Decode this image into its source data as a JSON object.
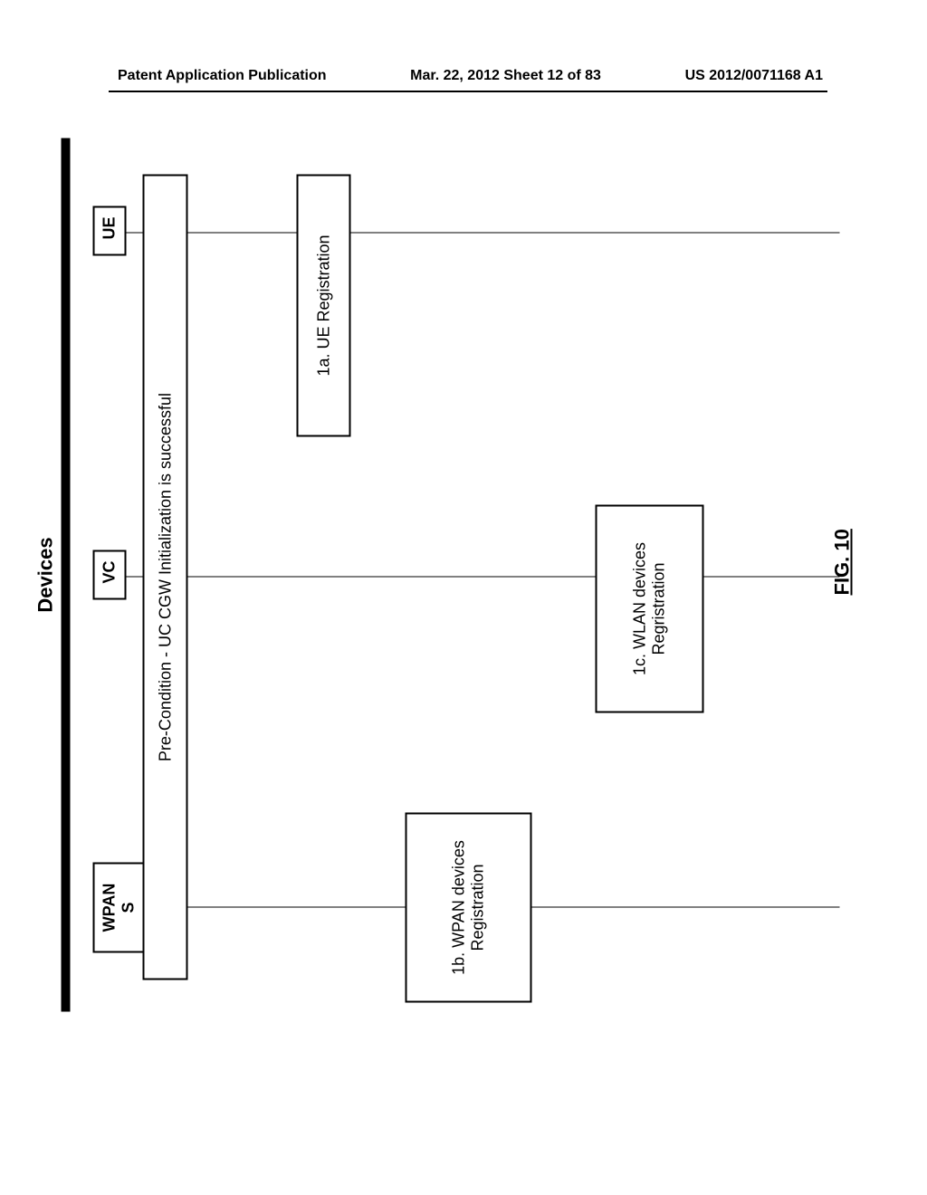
{
  "header": {
    "left": "Patent Application Publication",
    "center": "Mar. 22, 2012 Sheet 12 of 83",
    "right": "US 2012/0071168 A1"
  },
  "diagram": {
    "title": "Devices",
    "devices": {
      "wpans": "WPAN S",
      "vc": "VC",
      "ue": "UE"
    },
    "precondition": "Pre-Condition - UC CGW Initialization is successful",
    "registrations": {
      "ue": "1a. UE Registration",
      "wpan": "1b. WPAN devices Registration",
      "wlan": "1c. WLAN devices Regristration"
    },
    "figure_label": "FIG. 10"
  }
}
